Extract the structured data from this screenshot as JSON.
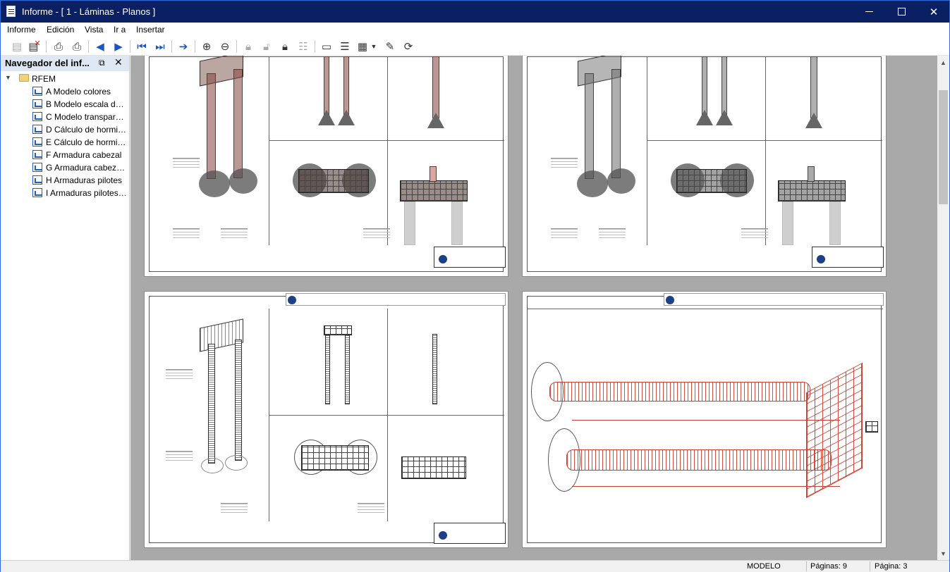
{
  "window": {
    "title": "Informe - [ 1 - Láminas - Planos ]",
    "minimize_glyph": "minimize-icon",
    "maximize_glyph": "maximize-icon",
    "close_glyph": "✕"
  },
  "menu": [
    "Informe",
    "Edición",
    "Vista",
    "Ir a",
    "Insertar"
  ],
  "toolbar_icons": [
    "new-report-icon",
    "delete-report-icon",
    "print-icon",
    "print-setup-icon",
    "previous-icon",
    "next-icon",
    "first-page-icon",
    "last-page-icon",
    "go-to-icon",
    "zoom-in-icon",
    "zoom-out-icon",
    "lock-icon",
    "unlock-icon",
    "lock-all-icon",
    "selection-icon",
    "page-setup-icon",
    "header-icon",
    "template-icon",
    "properties-icon",
    "refresh-icon"
  ],
  "navigator": {
    "title": "Navegador del inf...",
    "root": "RFEM",
    "items": [
      "A Modelo colores",
      "B Modelo escala de g...",
      "C Modelo transparen...",
      "D Cálculo de hormigó...",
      "E Cálculo de hormigó...",
      "F Armadura cabezal",
      "G Armadura cabezal ...",
      "H Armaduras pilotes",
      "I Armaduras pilotes g..."
    ]
  },
  "status": {
    "mode": "MODELO",
    "pages_total": "Páginas: 9",
    "page_current": "Página: 3"
  },
  "colors": {
    "titlebar": "#0b1f63",
    "navigator_header": "#dfe7f2",
    "preview_background": "#a9a9a9",
    "rebar_red": "#c9412f"
  }
}
